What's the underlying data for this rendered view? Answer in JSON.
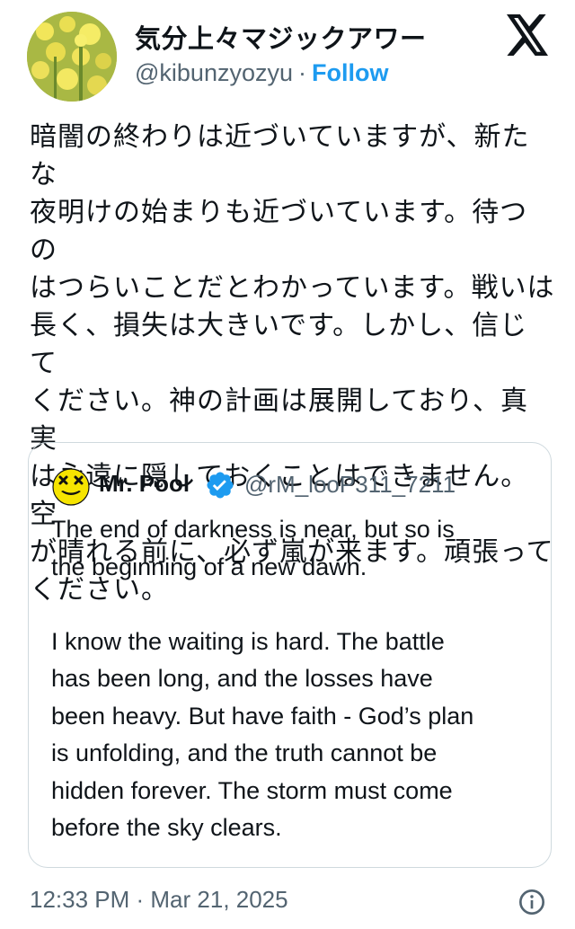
{
  "author": {
    "display_name": "気分上々マジックアワー",
    "handle": "@kibunzyozyu",
    "separator": "·",
    "follow_label": "Follow",
    "avatar_icon": "flower-field-avatar"
  },
  "platform_icon": "x-logo-icon",
  "tweet": {
    "text": "暗闇の終わりは近づいていますが、新たな\n夜明けの始まりも近づいています。待つの\nはつらいことだとわかっています。戦いは\n長く、損失は大きいです。しかし、信じて\nください。神の計画は展開しており、真実\nは永遠に隠しておくことはできません。空\nが晴れる前に、必ず嵐が来ます。頑張って\nください。"
  },
  "quoted": {
    "name": "Mr. Pool",
    "handle": "@rM_looP311_7211",
    "verified": true,
    "verified_color": "#1d9bf0",
    "avatar_icon": "smiley-face-avatar",
    "text": "The end of darkness is near, but so is\nthe beginning of a new dawn.\n\nI know the waiting is hard. The battle\nhas been long, and the losses have\nbeen heavy. But have faith - God’s plan\nis unfolding, and the truth cannot be\nhidden forever. The storm must come\nbefore the sky clears."
  },
  "footer": {
    "timestamp": "12:33 PM · Mar 21, 2025",
    "info_icon": "info-icon"
  },
  "colors": {
    "text": "#0f1419",
    "secondary": "#536471",
    "accent": "#1d9bf0",
    "border": "#cfd9de"
  }
}
